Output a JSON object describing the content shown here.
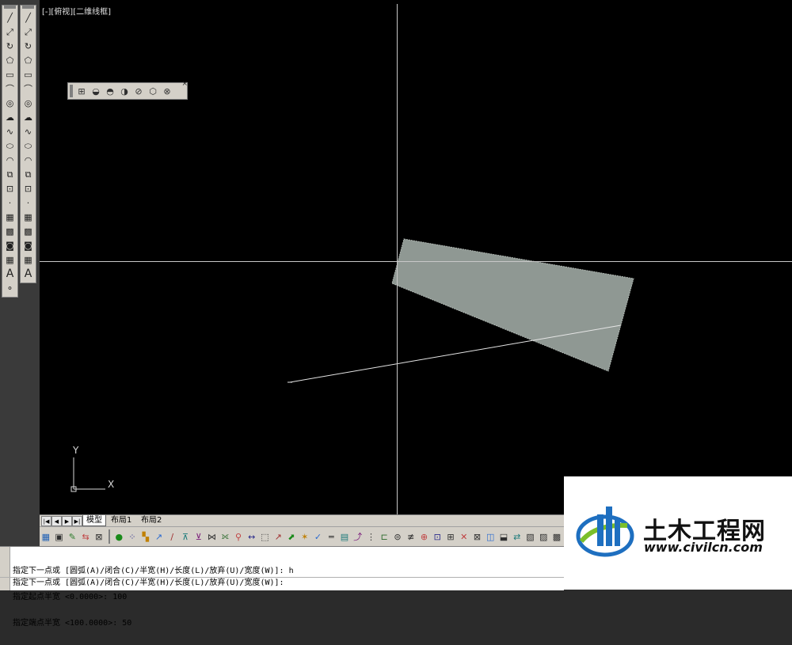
{
  "viewport": {
    "label": "[-][俯视][二维线框]"
  },
  "left_toolbar": {
    "column1_icons": [
      "line-icon",
      "construction-line-icon",
      "polyline-icon",
      "polygon-icon",
      "rectangle-icon",
      "arc-icon",
      "circle-icon",
      "revision-cloud-icon",
      "spline-icon",
      "ellipse-icon",
      "ellipse-arc-icon",
      "insert-block-icon",
      "make-block-icon",
      "point-icon",
      "hatch-icon",
      "gradient-icon",
      "region-icon",
      "table-icon",
      "mtext-icon",
      "add-selected-icon"
    ],
    "column2_icons": [
      "line-icon",
      "construction-line-icon",
      "polyline-icon",
      "polygon-icon",
      "rectangle-icon",
      "arc-icon",
      "circle-icon",
      "revision-cloud-icon",
      "spline-icon",
      "ellipse-icon",
      "ellipse-arc-icon",
      "insert-block-icon",
      "make-block-icon",
      "point-icon",
      "hatch-icon",
      "gradient-icon",
      "region-icon",
      "table-icon",
      "mtext-icon"
    ],
    "text_glyph": "A"
  },
  "float_toolbar": {
    "icons": [
      "view-3d-icon",
      "view-top-sphere-icon",
      "view-add-sphere-icon",
      "view-remove-sphere-icon",
      "orbit-icon",
      "box-view-icon",
      "delete-view-icon"
    ]
  },
  "ucs": {
    "x_label": "X",
    "y_label": "Y"
  },
  "tabs": {
    "items": [
      "模型",
      "布局1",
      "布局2"
    ],
    "active": "模型"
  },
  "bottom_toolbar": {
    "icon_count": 40
  },
  "command_line": {
    "history": [
      "指定下一点或 [圆弧(A)/闭合(C)/半宽(H)/长度(L)/放弃(U)/宽度(W)]: h",
      "指定起点半宽 <0.0000>: 100",
      "指定端点半宽 <100.0000>: 50"
    ],
    "current": "指定下一点或 [圆弧(A)/闭合(C)/半宽(H)/长度(L)/放弃(U)/宽度(W)]:"
  },
  "watermark": {
    "title": "土木工程网",
    "url": "www.civilcn.com"
  },
  "colors": {
    "viewport_bg": "#000000",
    "polyline_fill": "#8f9893",
    "crosshair": "#c8c8c8",
    "toolbar_bg": "#d4d0c8"
  }
}
